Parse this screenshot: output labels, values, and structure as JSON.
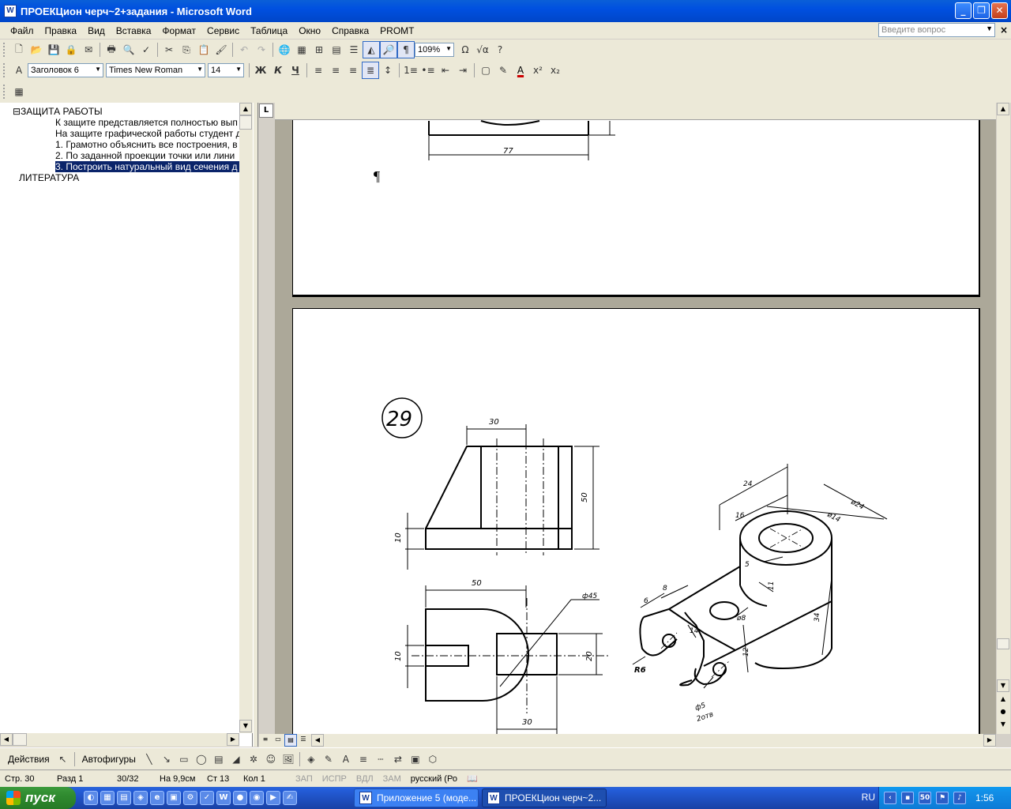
{
  "window": {
    "title": "ПРОЕКЦион черч~2+задания - Microsoft Word",
    "app_icon": "W"
  },
  "menu": {
    "items": [
      "Файл",
      "Правка",
      "Вид",
      "Вставка",
      "Формат",
      "Сервис",
      "Таблица",
      "Окно",
      "Справка",
      "PROMT"
    ],
    "ask_placeholder": "Введите вопрос"
  },
  "toolbar_standard": {
    "zoom": "109%"
  },
  "toolbar_format": {
    "style": "Заголовок 6",
    "font": "Times New Roman",
    "size": "14",
    "bold": "Ж",
    "italic": "К",
    "underline": "Ч"
  },
  "doc_map": {
    "items": [
      {
        "text": "⊟ЗАЩИТА РАБОТЫ",
        "level": 0
      },
      {
        "text": "К защите представляется полностью вып",
        "level": 1
      },
      {
        "text": "На защите графической работы студент д",
        "level": 1
      },
      {
        "text": "1. Грамотно объяснить все построения, в",
        "level": 1
      },
      {
        "text": "2. По заданной проекции точки или лини",
        "level": 1
      },
      {
        "text": "3. Построить натуральный вид сечения д",
        "level": 1,
        "selected": true
      },
      {
        "text": "ЛИТЕРАТУРА",
        "level": 0
      }
    ]
  },
  "document": {
    "pilcrow": "¶",
    "upper_dim": "77",
    "task_number": "29",
    "dims": {
      "top_width": "30",
      "height": "50",
      "base": "10",
      "plan_width": "50",
      "circle_dia": "ф45",
      "slot_h": "10",
      "rect_h": "20",
      "bottom_w": "30",
      "iso_24": "24",
      "iso_16": "16",
      "iso_d24": "ø24",
      "iso_d14": "ø14",
      "iso_5": "5",
      "iso_11": "11",
      "iso_34": "34",
      "iso_6": "6",
      "iso_8": "8",
      "iso_14": "14",
      "iso_d8": "ø8",
      "iso_12": "12",
      "iso_r6": "R6",
      "iso_d5": "ф5",
      "iso_2otv": "2отв"
    }
  },
  "drawing_toolbar": {
    "actions": "Действия",
    "autoshapes": "Автофигуры"
  },
  "status": {
    "page": "Стр. 30",
    "section": "Разд 1",
    "pages": "30/32",
    "at": "На 9,9см",
    "line": "Ст 13",
    "col": "Кол 1",
    "rec": "ЗАП",
    "trk": "ИСПР",
    "ext": "ВДЛ",
    "ovr": "ЗАМ",
    "lang": "русский (Ро"
  },
  "taskbar": {
    "start": "пуск",
    "tasks": [
      "Приложение 5 (моде...",
      "ПРОЕКЦион черч~2..."
    ],
    "lang": "RU",
    "clock": "1:56"
  }
}
